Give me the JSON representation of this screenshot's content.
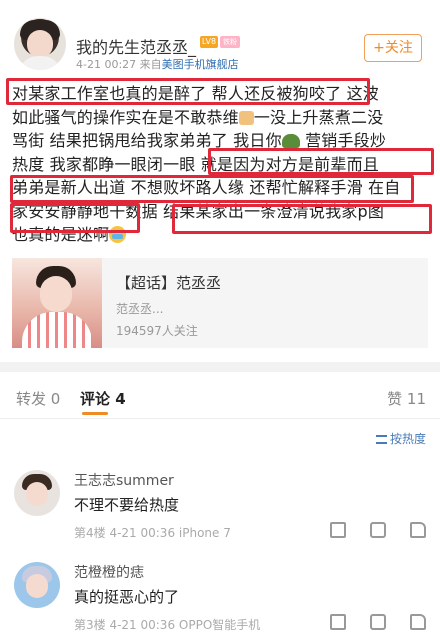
{
  "post": {
    "username": "我的先生范丞丞_",
    "level_badge": "LV8",
    "fan_badge": "铁粉",
    "time": "4-21 00:27",
    "source_prefix": "来自",
    "source": "美图手机旗舰店",
    "follow_label": "+关注",
    "body_lines": [
      "对某家工作室也真的是醉了 帮人还反被狗咬了 这波",
      "如此骚气的操作实在是不敢恭维",
      "一没上升蒸煮二没",
      "骂街 结果把锅甩给我家弟弟了 我日你",
      " 营销手段炒",
      "热度 我家都睁一眼闭一眼 就是因为对方是前辈而且",
      "弟弟是新人出道 不想败坏路人缘 还帮忙解释手滑 在自",
      "家安安静静地干数据 结果某家出一条澄清说我家p图",
      "也真的是迷啊"
    ],
    "emojis": [
      "bow-emoji",
      "dinosaur-emoji",
      "crying-emoji"
    ],
    "highlight_color": "#e0283b"
  },
  "super_topic": {
    "title": "【超话】范丞丞",
    "subtitle": "范丞丞...",
    "followers": "194597人关注"
  },
  "tabs": {
    "repost": "转发 0",
    "comment": "评论 4",
    "like": "赞 11"
  },
  "sort": {
    "label": "按热度"
  },
  "comments": [
    {
      "name": "王志志summer",
      "text": "不理不要给热度",
      "meta": "第4楼 4-21 00:36  iPhone 7"
    },
    {
      "name": "范橙橙的痣",
      "text": "真的挺恶心的了",
      "meta": "第3楼 4-21 00:36  OPPO智能手机"
    }
  ],
  "colors": {
    "accent": "#f08a24",
    "link": "#2f6fb3"
  }
}
